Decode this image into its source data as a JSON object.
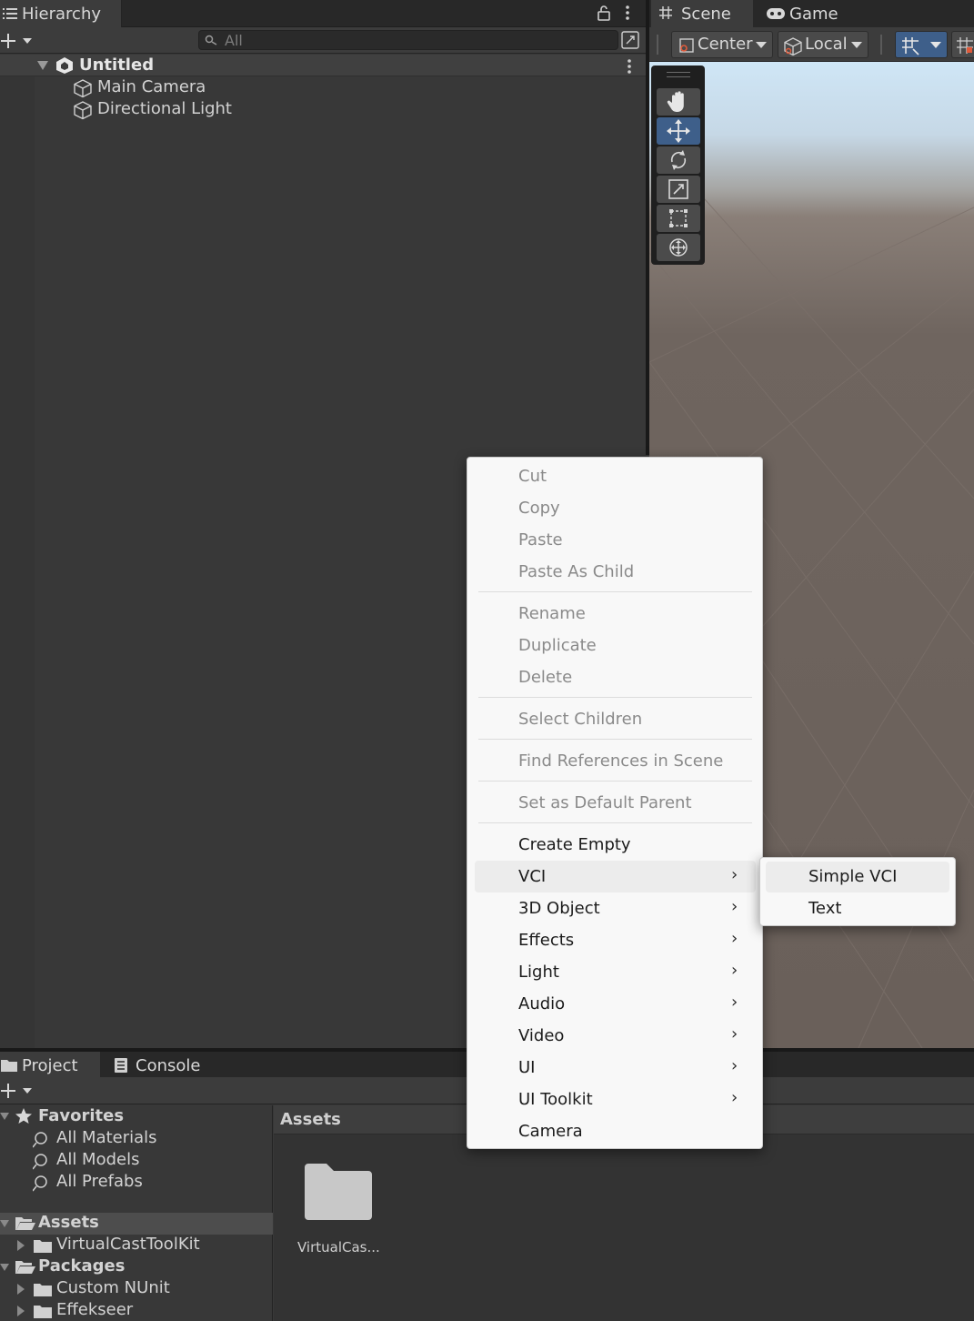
{
  "hierarchy": {
    "tab_label": "Hierarchy",
    "search_placeholder": "All",
    "scene_name": "Untitled",
    "objects": [
      "Main Camera",
      "Directional Light"
    ]
  },
  "scene": {
    "tabs": [
      {
        "label": "Scene",
        "icon": "hash-icon"
      },
      {
        "label": "Game",
        "icon": "gamepad-icon"
      }
    ],
    "pivot_mode": "Center",
    "pivot_rotation": "Local",
    "tools": [
      "hand-tool-icon",
      "move-tool-icon",
      "rotate-tool-icon",
      "scale-tool-icon",
      "rect-tool-icon",
      "transform-tool-icon"
    ],
    "active_tool": "move-tool-icon"
  },
  "context_menu": {
    "groups": [
      [
        {
          "label": "Cut",
          "enabled": false
        },
        {
          "label": "Copy",
          "enabled": false
        },
        {
          "label": "Paste",
          "enabled": false
        },
        {
          "label": "Paste As Child",
          "enabled": false
        }
      ],
      [
        {
          "label": "Rename",
          "enabled": false
        },
        {
          "label": "Duplicate",
          "enabled": false
        },
        {
          "label": "Delete",
          "enabled": false
        }
      ],
      [
        {
          "label": "Select Children",
          "enabled": false
        }
      ],
      [
        {
          "label": "Find References in Scene",
          "enabled": false
        }
      ],
      [
        {
          "label": "Set as Default Parent",
          "enabled": false
        }
      ],
      [
        {
          "label": "Create Empty",
          "enabled": true
        },
        {
          "label": "VCI",
          "enabled": true,
          "submenu": true,
          "highlighted": true
        },
        {
          "label": "3D Object",
          "enabled": true,
          "submenu": true
        },
        {
          "label": "Effects",
          "enabled": true,
          "submenu": true
        },
        {
          "label": "Light",
          "enabled": true,
          "submenu": true
        },
        {
          "label": "Audio",
          "enabled": true,
          "submenu": true
        },
        {
          "label": "Video",
          "enabled": true,
          "submenu": true
        },
        {
          "label": "UI",
          "enabled": true,
          "submenu": true
        },
        {
          "label": "UI Toolkit",
          "enabled": true,
          "submenu": true
        },
        {
          "label": "Camera",
          "enabled": true
        }
      ]
    ]
  },
  "submenu": {
    "items": [
      {
        "label": "Simple VCI",
        "highlighted": true
      },
      {
        "label": "Text"
      }
    ]
  },
  "project": {
    "tabs": [
      {
        "label": "Project",
        "icon": "folder-icon"
      },
      {
        "label": "Console",
        "icon": "console-icon"
      }
    ],
    "favorites": {
      "label": "Favorites",
      "items": [
        "All Materials",
        "All Models",
        "All Prefabs"
      ]
    },
    "assets": {
      "label": "Assets",
      "children": [
        "VirtualCastToolKit"
      ]
    },
    "packages": {
      "label": "Packages",
      "children": [
        "Custom NUnit",
        "Effekseer"
      ]
    },
    "breadcrumb": "Assets",
    "grid_items": [
      {
        "label": "VirtualCas...",
        "icon": "folder-icon"
      }
    ]
  },
  "colors": {
    "editor_bg": "#383838",
    "menu_bg": "#f8f8f8",
    "selection_blue": "#3e5f8a"
  }
}
